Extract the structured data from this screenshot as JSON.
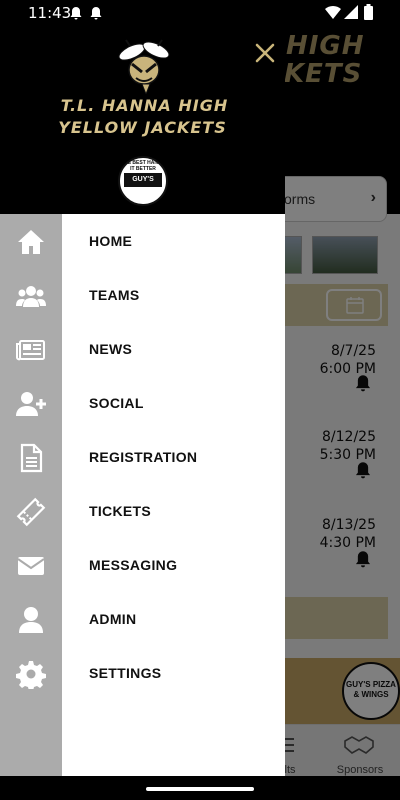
{
  "status_bar": {
    "time": "11:43"
  },
  "background": {
    "header_title_line1": "HIGH",
    "header_title_line2": "KETS",
    "forms_label": "orms",
    "events": [
      {
        "date": "8/7/25",
        "time": "6:00 PM"
      },
      {
        "date": "8/12/25",
        "time": "5:30 PM"
      },
      {
        "date": "8/13/25",
        "time": "4:30 PM"
      }
    ],
    "tabs": [
      {
        "label": "lts"
      },
      {
        "label": "Sponsors"
      }
    ],
    "ad_badge_text": "GUY'S PIZZA & WINGS"
  },
  "drawer": {
    "school_name_line1": "T.L. HANNA HIGH",
    "school_name_line2": "YELLOW JACKETS",
    "sponsor_rim_text": "THE BEST HANDS IT BETTER",
    "sponsor_badge_text": "GUY'S PIZZA &",
    "menu_items": [
      {
        "label": "HOME",
        "icon": "home-icon"
      },
      {
        "label": "TEAMS",
        "icon": "users-icon"
      },
      {
        "label": "NEWS",
        "icon": "newspaper-icon"
      },
      {
        "label": "SOCIAL",
        "icon": "user-plus-icon"
      },
      {
        "label": "REGISTRATION",
        "icon": "document-icon"
      },
      {
        "label": "TICKETS",
        "icon": "ticket-icon"
      },
      {
        "label": "MESSAGING",
        "icon": "envelope-icon"
      },
      {
        "label": "ADMIN",
        "icon": "user-icon"
      },
      {
        "label": "SETTINGS",
        "icon": "gear-icon"
      }
    ]
  },
  "colors": {
    "accent_gold": "#d8c48e",
    "rail_gray": "#ababab",
    "close_gold": "#c9b57a"
  }
}
